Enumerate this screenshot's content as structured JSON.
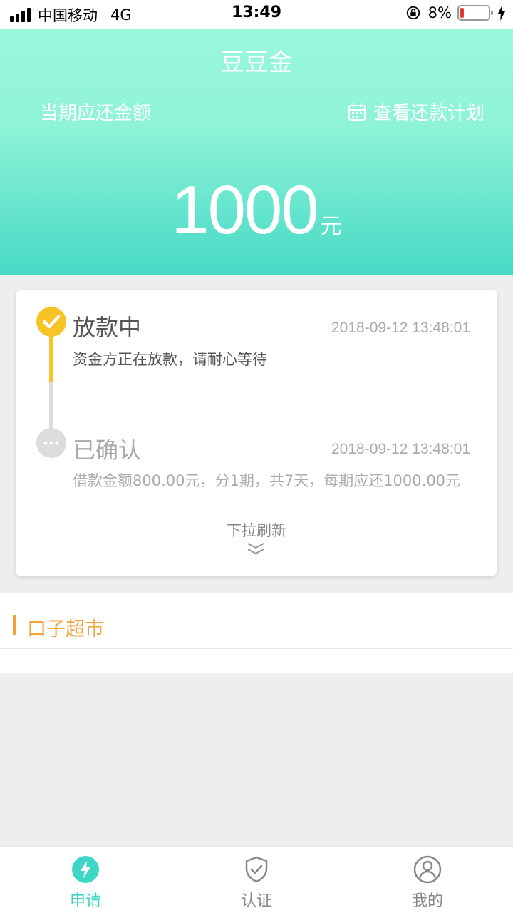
{
  "status_bar": {
    "carrier": "中国移动",
    "network": "4G",
    "time": "13:49",
    "battery": "8%"
  },
  "header": {
    "app_title": "豆豆金",
    "due_label": "当期应还金额",
    "plan_link": "查看还款计划",
    "amount": "1000",
    "unit": "元"
  },
  "timeline": {
    "steps": [
      {
        "title": "放款中",
        "time": "2018-09-12 13:48:01",
        "desc": "资金方正在放款，请耐心等待",
        "state": "active",
        "color": "#f7c428"
      },
      {
        "title": "已确认",
        "time": "2018-09-12 13:48:01",
        "desc": "借款金额800.00元，分1期，共7天，每期应还1000.00元",
        "state": "done",
        "color": "#dcdcdc"
      }
    ],
    "pull_hint": "下拉刷新"
  },
  "market": {
    "title": "口子超市",
    "accent": "#f2a33c"
  },
  "tabbar": {
    "tabs": [
      {
        "label": "申请",
        "icon": "lightning-icon",
        "active": true
      },
      {
        "label": "认证",
        "icon": "shield-check-icon",
        "active": false
      },
      {
        "label": "我的",
        "icon": "user-icon",
        "active": false
      }
    ],
    "active_color": "#3ed7c5"
  }
}
